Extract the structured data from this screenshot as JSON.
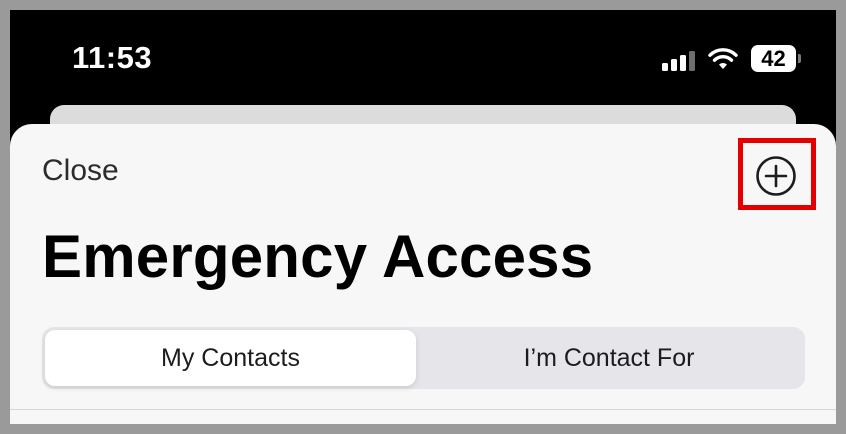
{
  "status_bar": {
    "time": "11:53",
    "battery_level": "42",
    "signal_bars_active": 3,
    "signal_bars_total": 4
  },
  "sheet": {
    "close_label": "Close",
    "add_icon": "plus-circle-icon",
    "highlight_color": "#e40000",
    "title": "Emergency Access",
    "segments": [
      {
        "label": "My Contacts",
        "selected": true
      },
      {
        "label": "I’m Contact For",
        "selected": false
      }
    ]
  }
}
